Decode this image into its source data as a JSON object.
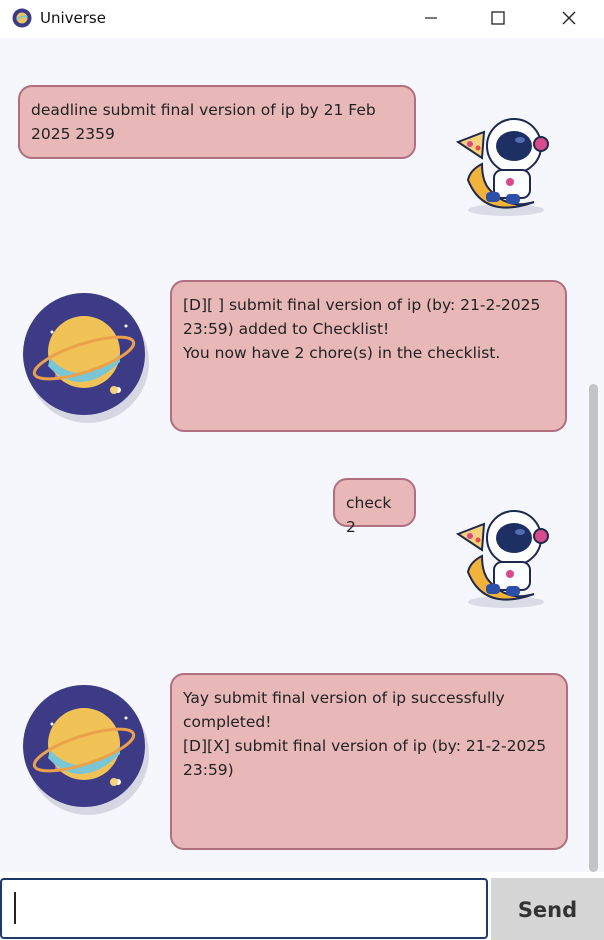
{
  "window": {
    "title": "Universe",
    "icons": {
      "app": "planet-icon",
      "minimize": "minimize-icon",
      "maximize": "maximize-icon",
      "close": "close-icon"
    }
  },
  "messages": [
    {
      "sender": "user",
      "avatar": "astronaut-icon",
      "text": "deadline submit final version of ip by 21 Feb\n2025 2359"
    },
    {
      "sender": "bot",
      "avatar": "planet-icon",
      "text": "[D][ ] submit final version of ip (by: 21-2-2025\n23:59) added to Checklist!\nYou now have 2 chore(s) in the checklist."
    },
    {
      "sender": "user",
      "avatar": "astronaut-icon",
      "text": "check 2"
    },
    {
      "sender": "bot",
      "avatar": "planet-icon",
      "text": "Yay submit final version of ip successfully\ncompleted!\n[D][X] submit final version of ip (by: 21-2-2025\n23:59)"
    }
  ],
  "input": {
    "value": "",
    "placeholder": ""
  },
  "send_button": {
    "label": "Send"
  },
  "colors": {
    "bubble_fill": "#e8b8b8",
    "bubble_border": "#b06f7f",
    "chat_background": "#f6f7fd",
    "input_border": "#1d3b66",
    "send_background": "#d6d6d6"
  }
}
